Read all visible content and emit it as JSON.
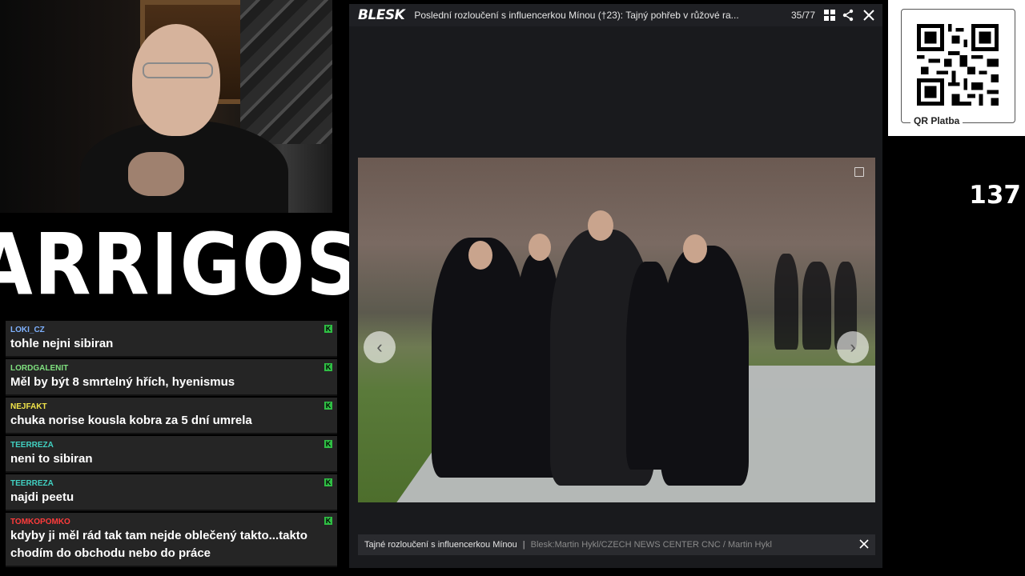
{
  "logo_text": "ARRIGOS",
  "chat": [
    {
      "user": "LOKI_CZ",
      "user_color": "#7fb2ff",
      "text": "tohle nejni sibiran"
    },
    {
      "user": "LORDGALENIT",
      "user_color": "#7fe07f",
      "text": "Měl by být 8 smrtelný hřích, hyenismus"
    },
    {
      "user": "NEJFAKT",
      "user_color": "#f1e44a",
      "text": "chuka norise kousla kobra za 5 dní umrela"
    },
    {
      "user": "TEERREZA",
      "user_color": "#41d1c2",
      "text": "neni to sibiran"
    },
    {
      "user": "TEERREZA",
      "user_color": "#41d1c2",
      "text": "najdi peetu"
    },
    {
      "user": "TOMKOPOMKO",
      "user_color": "#ff3b3b",
      "text": "kdyby ji měl rád tak tam nejde oblečený takto...takto chodím do obchodu nebo do práce"
    }
  ],
  "gallery": {
    "brand": "BLESK",
    "title": "Poslední rozloučení s influencerkou Mínou (†23): Tajný pohřeb v růžové ra...",
    "counter": "35/77",
    "icons": [
      "grid-icon",
      "share-icon",
      "close-icon"
    ],
    "caption_text": "Tajné rozloučení s influencerkou Mínou",
    "caption_separator": "|",
    "caption_credit": "Blesk:Martin Hykl/CZECH NEWS CENTER CNC / Martin Hykl"
  },
  "qr": {
    "label": "QR Platba"
  },
  "viewer_count": "137",
  "colors": {
    "chat_badge": "#2fbf44",
    "gallery_bg": "#191a1d",
    "accent": "#ffffff"
  }
}
